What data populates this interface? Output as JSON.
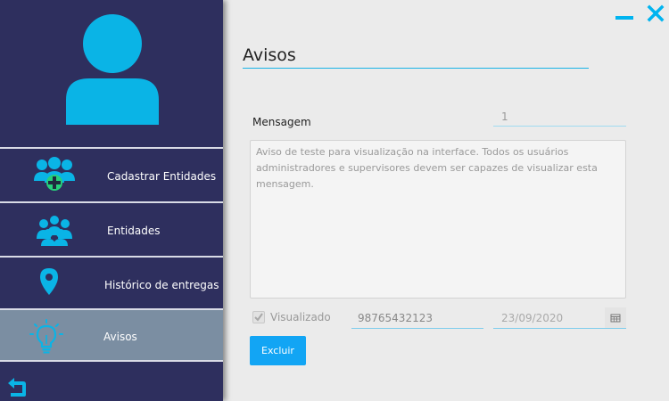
{
  "window": {
    "minimize_icon": "minimize-icon",
    "close_icon": "close-icon",
    "accent_color": "#00b4f0"
  },
  "sidebar": {
    "background": "#2e2f5e",
    "avatar_icon": "user-avatar-icon",
    "items": [
      {
        "label": "Cadastrar Entidades",
        "icon": "add-group-icon",
        "active": false
      },
      {
        "label": "Entidades",
        "icon": "group-icon",
        "active": false
      },
      {
        "label": "Histórico de entregas",
        "icon": "location-pin-icon",
        "active": false
      },
      {
        "label": "Avisos",
        "icon": "lightbulb-icon",
        "active": true
      }
    ],
    "back_icon": "back-arrow-icon"
  },
  "main": {
    "title": "Avisos",
    "message_label": "Mensagem",
    "message_id": "1",
    "message_text": "Aviso de teste para visualização na interface. Todos os usuários administradores e supervisores devem ser capazes de visualizar esta mensagem.",
    "viewed_label": "Visualizado",
    "viewed_checked": true,
    "cpf": "98765432123",
    "date": "23/09/2020",
    "calendar_icon": "calendar-icon",
    "delete_label": "Excluir",
    "button_color": "#12a5f4"
  }
}
